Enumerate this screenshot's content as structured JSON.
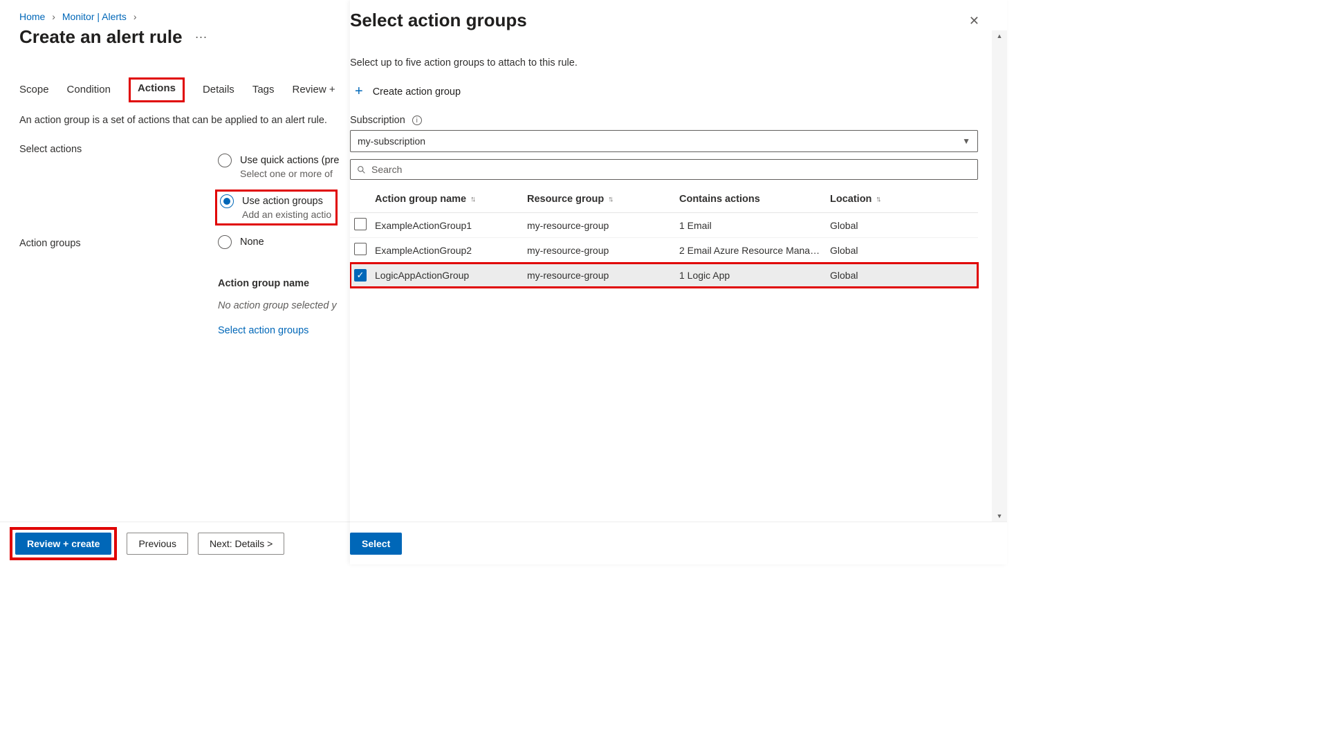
{
  "breadcrumb": {
    "home": "Home",
    "monitor": "Monitor | Alerts"
  },
  "page_title": "Create an alert rule",
  "tabs": {
    "scope": "Scope",
    "condition": "Condition",
    "actions": "Actions",
    "details": "Details",
    "tags": "Tags",
    "review": "Review +"
  },
  "description": "An action group is a set of actions that can be applied to an alert rule.",
  "select_actions_label": "Select actions",
  "action_groups_label": "Action groups",
  "options": {
    "quick_main": "Use quick actions (pre",
    "quick_sub": "Select one or more of",
    "ag_main": "Use action groups",
    "ag_sub": "Add an existing actio",
    "none_main": "None"
  },
  "ag_table": {
    "header": "Action group name",
    "empty": "No action group selected y",
    "link": "Select action groups"
  },
  "buttons": {
    "review_create": "Review + create",
    "previous": "Previous",
    "next": "Next: Details >",
    "select": "Select"
  },
  "panel": {
    "title": "Select action groups",
    "sub": "Select up to five action groups to attach to this rule.",
    "create": "Create action group",
    "subscription_label": "Subscription",
    "subscription_value": "my-subscription",
    "search_placeholder": "Search",
    "columns": {
      "name": "Action group name",
      "rg": "Resource group",
      "actions": "Contains actions",
      "loc": "Location"
    },
    "rows": [
      {
        "checked": false,
        "highlighted": false,
        "name": "ExampleActionGroup1",
        "rg": "my-resource-group",
        "actions": "1 Email",
        "loc": "Global"
      },
      {
        "checked": false,
        "highlighted": false,
        "name": "ExampleActionGroup2",
        "rg": "my-resource-group",
        "actions": "2 Email Azure Resource Mana…",
        "loc": "Global"
      },
      {
        "checked": true,
        "highlighted": true,
        "name": "LogicAppActionGroup",
        "rg": "my-resource-group",
        "actions": "1 Logic App",
        "loc": "Global"
      }
    ]
  }
}
